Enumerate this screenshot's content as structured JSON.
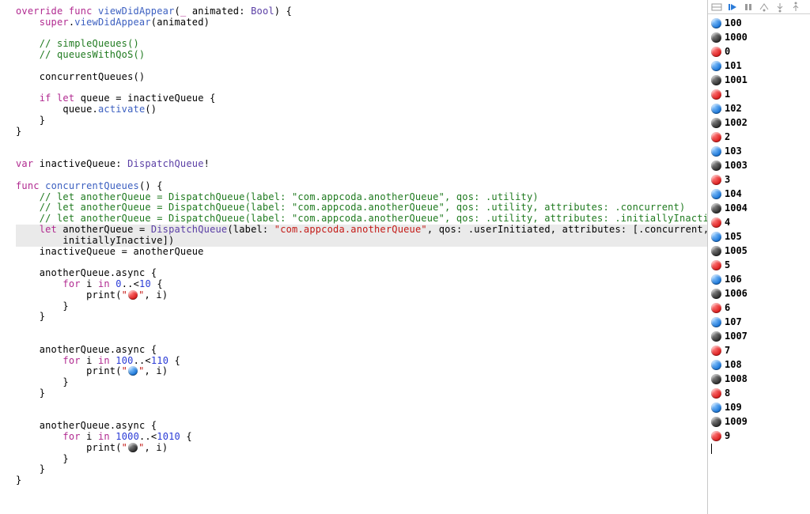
{
  "code": {
    "override": "override",
    "func": "func",
    "viewDidAppear": "viewDidAppear",
    "underscore": "_",
    "animated": "animated",
    "Bool": "Bool",
    "super": "super",
    "comment_simple": "// simpleQueues()",
    "comment_qos": "// queuesWithQoS()",
    "concurrentQueuesCall": "concurrentQueues()",
    "if": "if",
    "let": "let",
    "queue": "queue",
    "inactiveQueue": "inactiveQueue",
    "activate": "activate",
    "var": "var",
    "DispatchQueue": "DispatchQueue",
    "concurrentQueuesDecl": "concurrentQueues",
    "comment_line1": "// let anotherQueue = DispatchQueue(label: \"com.appcoda.anotherQueue\", qos: .utility)",
    "comment_line2": "// let anotherQueue = DispatchQueue(label: \"com.appcoda.anotherQueue\", qos: .utility, attributes: .concurrent)",
    "comment_line3": "// let anotherQueue = DispatchQueue(label: \"com.appcoda.anotherQueue\", qos: .utility, attributes: .initiallyInactive)",
    "DispatchQueue_call": "DispatchQueue",
    "label_string": "\"com.appcoda.anotherQueue\"",
    "qos_label": "qos",
    "userInitiated": "userInitiated",
    "attributes_label": "attributes",
    "concurrent": "concurrent",
    "initiallyInactive": "initiallyInactive",
    "anotherQueue": "anotherQueue",
    "assignInactive": "inactiveQueue = anotherQueue",
    "asyncCall": "async",
    "for": "for",
    "in": "in",
    "i": "i",
    "range1_lo": "0",
    "range1_hi": "10",
    "range2_lo": "100",
    "range2_hi": "110",
    "range3_lo": "1000",
    "range3_hi": "1010",
    "print": "print",
    "print_arg_i": ", i)",
    "label_label": "label"
  },
  "output": [
    {
      "color": "blue",
      "value": "100"
    },
    {
      "color": "black",
      "value": "1000"
    },
    {
      "color": "red",
      "value": "0"
    },
    {
      "color": "blue",
      "value": "101"
    },
    {
      "color": "black",
      "value": "1001"
    },
    {
      "color": "red",
      "value": "1"
    },
    {
      "color": "blue",
      "value": "102"
    },
    {
      "color": "black",
      "value": "1002"
    },
    {
      "color": "red",
      "value": "2"
    },
    {
      "color": "blue",
      "value": "103"
    },
    {
      "color": "black",
      "value": "1003"
    },
    {
      "color": "red",
      "value": "3"
    },
    {
      "color": "blue",
      "value": "104"
    },
    {
      "color": "black",
      "value": "1004"
    },
    {
      "color": "red",
      "value": "4"
    },
    {
      "color": "blue",
      "value": "105"
    },
    {
      "color": "black",
      "value": "1005"
    },
    {
      "color": "red",
      "value": "5"
    },
    {
      "color": "blue",
      "value": "106"
    },
    {
      "color": "black",
      "value": "1006"
    },
    {
      "color": "red",
      "value": "6"
    },
    {
      "color": "blue",
      "value": "107"
    },
    {
      "color": "black",
      "value": "1007"
    },
    {
      "color": "red",
      "value": "7"
    },
    {
      "color": "blue",
      "value": "108"
    },
    {
      "color": "black",
      "value": "1008"
    },
    {
      "color": "red",
      "value": "8"
    },
    {
      "color": "blue",
      "value": "109"
    },
    {
      "color": "black",
      "value": "1009"
    },
    {
      "color": "red",
      "value": "9"
    }
  ]
}
